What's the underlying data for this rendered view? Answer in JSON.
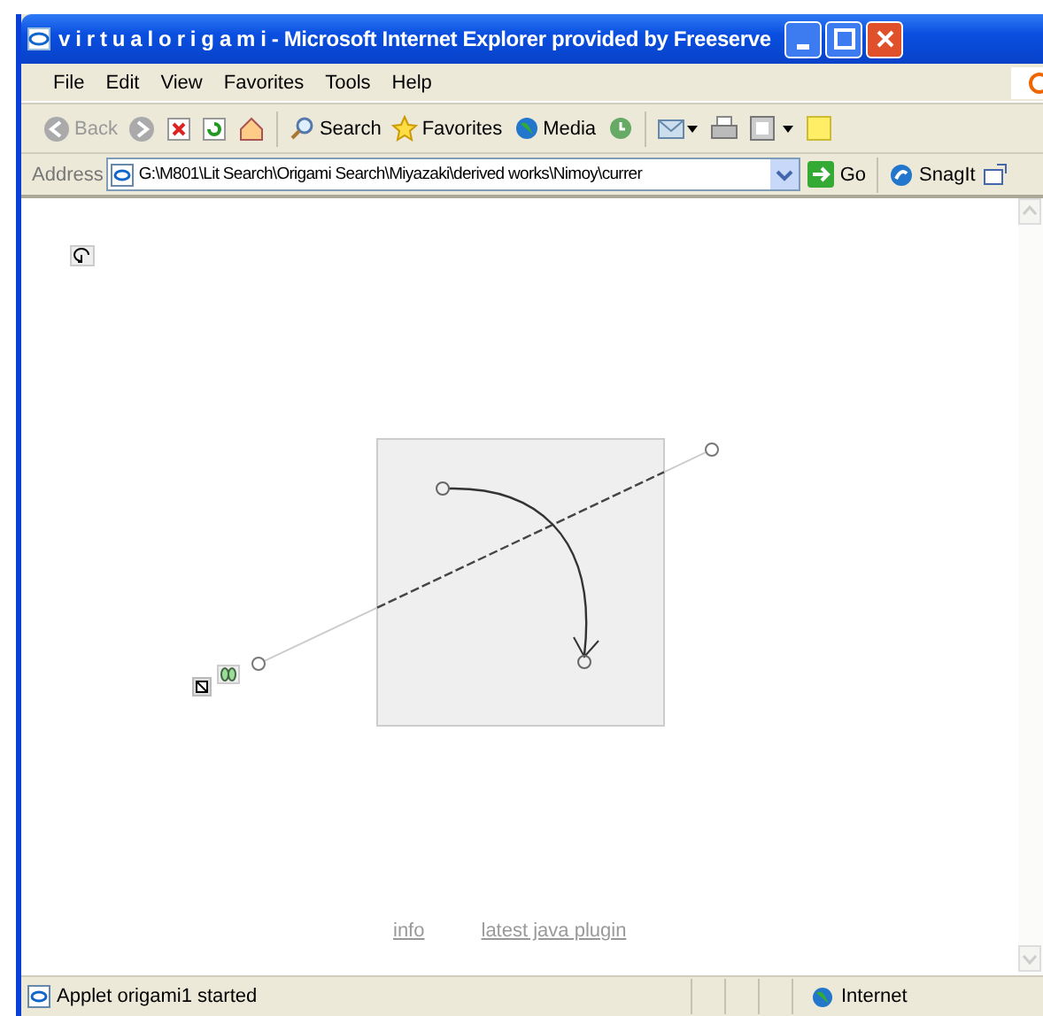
{
  "window": {
    "title": "v i r t u a l o r i g a m i - Microsoft Internet Explorer provided by Freeserve"
  },
  "menu": [
    "File",
    "Edit",
    "View",
    "Favorites",
    "Tools",
    "Help"
  ],
  "toolbar": [
    {
      "kind": "back",
      "label": "Back",
      "disabled": true
    },
    {
      "kind": "forward",
      "disabled": true
    },
    {
      "kind": "stop"
    },
    {
      "kind": "refresh"
    },
    {
      "kind": "home"
    },
    {
      "kind": "search",
      "label": "Search"
    },
    {
      "kind": "favorites",
      "label": "Favorites"
    },
    {
      "kind": "media",
      "label": "Media"
    },
    {
      "kind": "history"
    },
    {
      "kind": "mail"
    },
    {
      "kind": "print"
    },
    {
      "kind": "edit"
    },
    {
      "kind": "note"
    }
  ],
  "address": {
    "label": "Address",
    "value": "G:\\M801\\Lit Search\\Origami Search\\Miyazaki\\derived works\\Nimoy\\currer",
    "go": "Go",
    "extra": "SnagIt"
  },
  "links": [
    "info",
    "latest java plugin"
  ],
  "status_bar": {
    "text": "Applet origami1 started",
    "zone": "Internet"
  }
}
